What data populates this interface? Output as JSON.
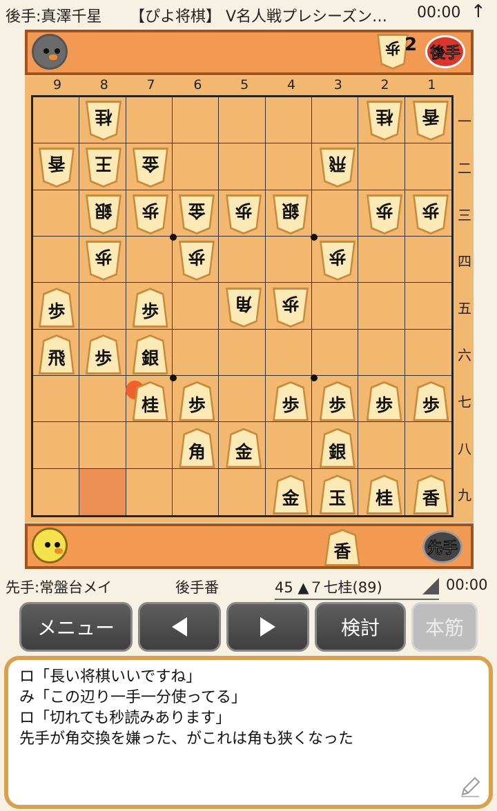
{
  "header": {
    "gote_player": "後手:真澤千星",
    "title": "【ぴよ将棋】 V名人戦プレシーズン…",
    "time": "00:00",
    "arrow_icon": "up-arrow-icon"
  },
  "gote_komadai": {
    "badge": "後手",
    "hand": [
      {
        "piece": "歩",
        "count": "2"
      }
    ]
  },
  "sente_komadai": {
    "badge": "先手",
    "hand": [
      {
        "piece": "香"
      }
    ]
  },
  "board": {
    "files": [
      "9",
      "8",
      "7",
      "6",
      "5",
      "4",
      "3",
      "2",
      "1"
    ],
    "ranks": [
      "一",
      "二",
      "三",
      "四",
      "五",
      "六",
      "七",
      "八",
      "九"
    ],
    "last_move_square": {
      "file": 8,
      "rank": 9
    },
    "move_marker_square": {
      "file": 7,
      "rank": 7
    },
    "pieces": [
      {
        "label": "桂",
        "side": "gote",
        "file": 8,
        "rank": 1
      },
      {
        "label": "桂",
        "side": "gote",
        "file": 2,
        "rank": 1
      },
      {
        "label": "香",
        "side": "gote",
        "file": 1,
        "rank": 1
      },
      {
        "label": "香",
        "side": "gote",
        "file": 9,
        "rank": 2
      },
      {
        "label": "王",
        "side": "gote",
        "file": 8,
        "rank": 2
      },
      {
        "label": "金",
        "side": "gote",
        "file": 7,
        "rank": 2
      },
      {
        "label": "飛",
        "side": "gote",
        "file": 3,
        "rank": 2
      },
      {
        "label": "銀",
        "side": "gote",
        "file": 8,
        "rank": 3
      },
      {
        "label": "歩",
        "side": "gote",
        "file": 7,
        "rank": 3
      },
      {
        "label": "金",
        "side": "gote",
        "file": 6,
        "rank": 3
      },
      {
        "label": "歩",
        "side": "gote",
        "file": 5,
        "rank": 3
      },
      {
        "label": "銀",
        "side": "gote",
        "file": 4,
        "rank": 3
      },
      {
        "label": "歩",
        "side": "gote",
        "file": 2,
        "rank": 3
      },
      {
        "label": "歩",
        "side": "gote",
        "file": 1,
        "rank": 3
      },
      {
        "label": "歩",
        "side": "gote",
        "file": 8,
        "rank": 4
      },
      {
        "label": "歩",
        "side": "gote",
        "file": 6,
        "rank": 4
      },
      {
        "label": "歩",
        "side": "gote",
        "file": 3,
        "rank": 4
      },
      {
        "label": "角",
        "side": "gote",
        "file": 5,
        "rank": 5
      },
      {
        "label": "歩",
        "side": "gote",
        "file": 4,
        "rank": 5
      },
      {
        "label": "歩",
        "side": "sente",
        "file": 9,
        "rank": 5
      },
      {
        "label": "歩",
        "side": "sente",
        "file": 7,
        "rank": 5
      },
      {
        "label": "飛",
        "side": "sente",
        "file": 9,
        "rank": 6
      },
      {
        "label": "歩",
        "side": "sente",
        "file": 8,
        "rank": 6
      },
      {
        "label": "銀",
        "side": "sente",
        "file": 7,
        "rank": 6
      },
      {
        "label": "桂",
        "side": "sente",
        "file": 7,
        "rank": 7
      },
      {
        "label": "歩",
        "side": "sente",
        "file": 6,
        "rank": 7
      },
      {
        "label": "歩",
        "side": "sente",
        "file": 4,
        "rank": 7
      },
      {
        "label": "歩",
        "side": "sente",
        "file": 3,
        "rank": 7
      },
      {
        "label": "歩",
        "side": "sente",
        "file": 2,
        "rank": 7
      },
      {
        "label": "歩",
        "side": "sente",
        "file": 1,
        "rank": 7
      },
      {
        "label": "角",
        "side": "sente",
        "file": 6,
        "rank": 8
      },
      {
        "label": "金",
        "side": "sente",
        "file": 5,
        "rank": 8
      },
      {
        "label": "銀",
        "side": "sente",
        "file": 3,
        "rank": 8
      },
      {
        "label": "金",
        "side": "sente",
        "file": 4,
        "rank": 9
      },
      {
        "label": "玉",
        "side": "sente",
        "file": 3,
        "rank": 9
      },
      {
        "label": "桂",
        "side": "sente",
        "file": 2,
        "rank": 9
      },
      {
        "label": "香",
        "side": "sente",
        "file": 1,
        "rank": 9
      }
    ]
  },
  "info": {
    "sente_player": "先手:常盤台メイ",
    "turn": "後手番",
    "move": "45 ▲７七桂(89)",
    "time": "00:00"
  },
  "buttons": {
    "menu": "メニュー",
    "prev_icon": "triangle-left-icon",
    "next_icon": "triangle-right-icon",
    "study": "検討",
    "main_line": "本筋"
  },
  "comments": [
    "ロ「長い将棋いいですね」",
    "み「この辺り一手一分使ってる」",
    "ロ「切れても秒読みあります」",
    "先手が角交換を嫌った、がこれは角も狭くなった"
  ],
  "colors": {
    "board": "#f2b86f",
    "komadai": "#f29a54",
    "highlight": "#ec8f55",
    "marker": "#f0602c",
    "button": "#4a4a4a"
  }
}
